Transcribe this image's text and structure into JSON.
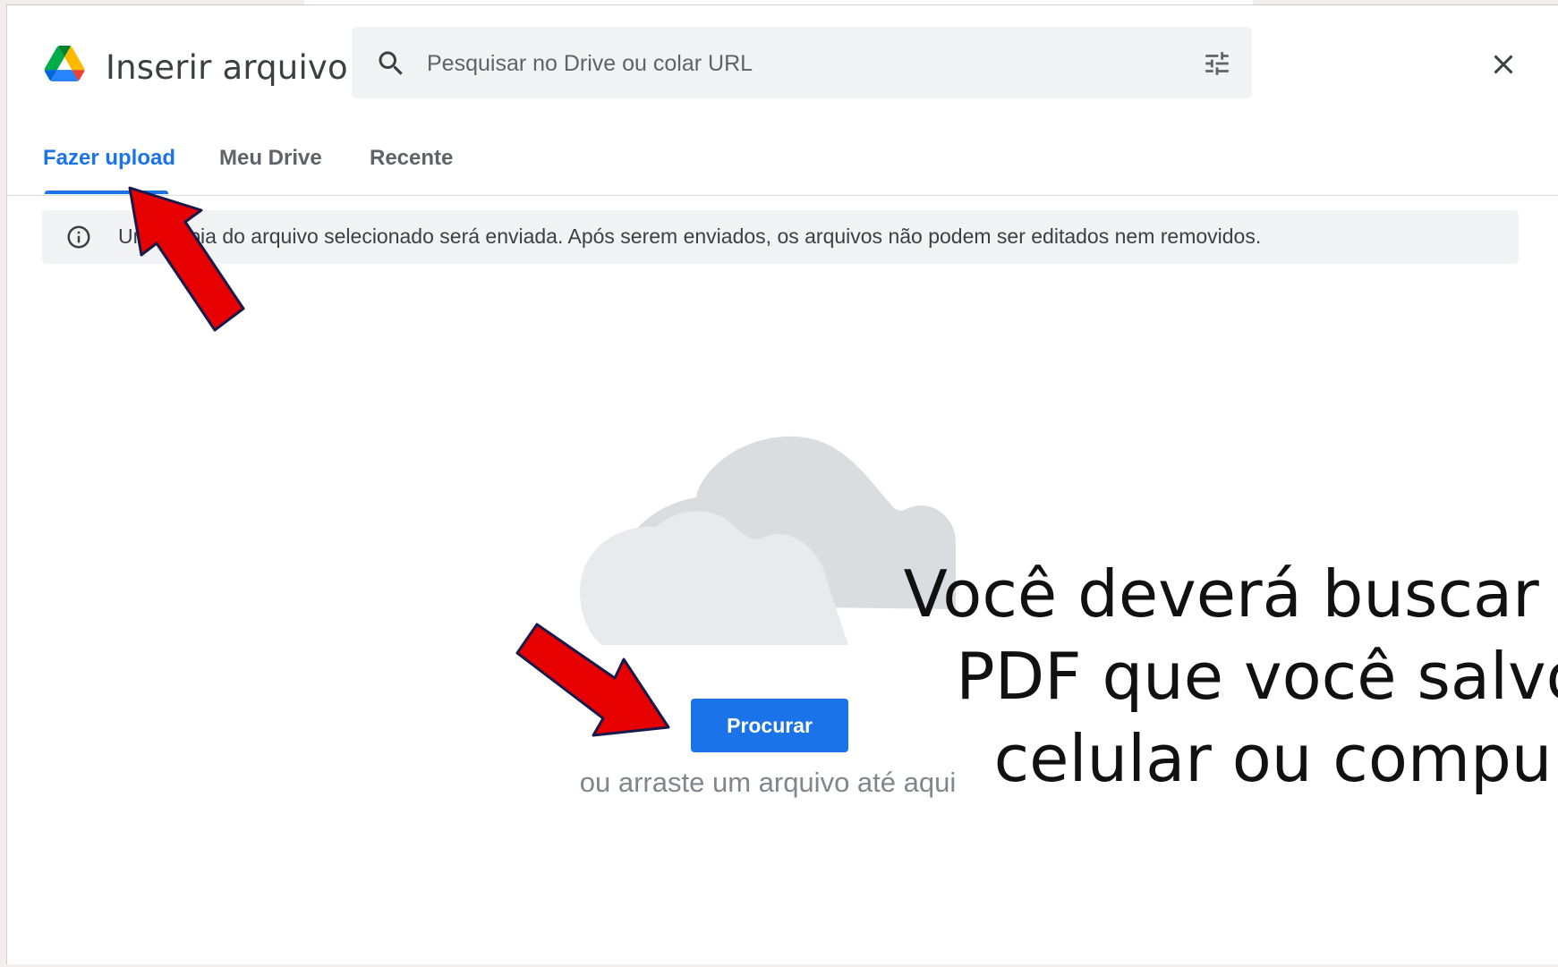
{
  "dialog": {
    "title": "Inserir arquivo",
    "close_icon": "close-icon",
    "logo_icon": "google-drive-logo"
  },
  "search": {
    "placeholder": "Pesquisar no Drive ou colar URL",
    "search_icon": "search-icon",
    "filter_icon": "tune-icon"
  },
  "tabs": [
    {
      "label": "Fazer upload",
      "active": true
    },
    {
      "label": "Meu Drive",
      "active": false
    },
    {
      "label": "Recente",
      "active": false
    }
  ],
  "info_banner": {
    "icon": "info-icon",
    "text": "Uma cópia do arquivo selecionado será enviada. Após serem enviados, os arquivos não podem ser editados nem removidos."
  },
  "upload_area": {
    "illustration": "cloud-illustration",
    "browse_label": "Procurar",
    "drag_hint": "ou arraste um arquivo até aqui"
  },
  "overlay": {
    "caption_lines": [
      "Você deverá buscar p",
      "PDF que você salvo",
      "celular ou compu"
    ],
    "arrow_color": "#e60000"
  },
  "colors": {
    "accent": "#1a73e8",
    "arrow": "#e60000"
  }
}
